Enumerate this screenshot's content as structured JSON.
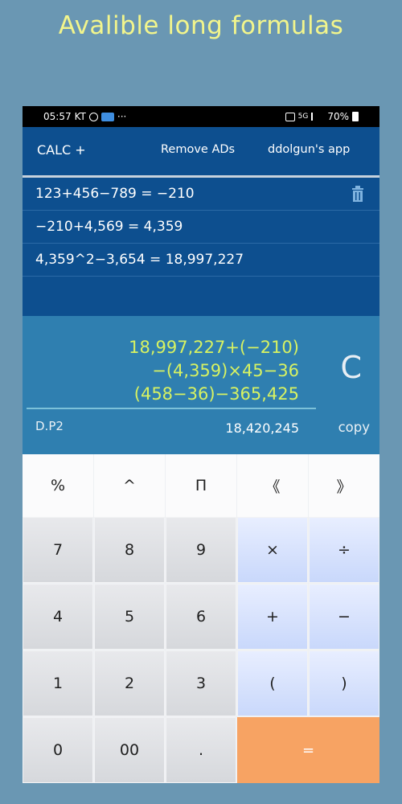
{
  "promo": {
    "title": "Avalible long formulas"
  },
  "status": {
    "time": "05:57",
    "carrier": "KT",
    "network": "5G",
    "battery": "70%"
  },
  "appbar": {
    "title": "CALC +",
    "remove_ads": "Remove ADs",
    "developer": "ddolgun's app"
  },
  "history": [
    {
      "text": "123+456−789 = −210"
    },
    {
      "text": "−210+4,569 = 4,359"
    },
    {
      "text": "4,359^2−3,654 = 18,997,227"
    },
    {
      "text": ""
    }
  ],
  "display": {
    "expression_lines": [
      "18,997,227+(−210)",
      "−(4,359)×45−36",
      "(458−36)−365,425"
    ],
    "clear_label": "C",
    "decimal_places": "D.P2",
    "result": "18,420,245",
    "copy_label": "copy"
  },
  "keypad": {
    "top_row": [
      "%",
      "^",
      "Π",
      "《",
      "》"
    ],
    "row1": [
      "7",
      "8",
      "9",
      "×",
      "÷"
    ],
    "row2": [
      "4",
      "5",
      "6",
      "+",
      "−"
    ],
    "row3": [
      "1",
      "2",
      "3",
      "(",
      ")"
    ],
    "row4": [
      "0",
      "00",
      ".",
      "="
    ]
  },
  "colors": {
    "accent": "#0d4f8f",
    "expression": "#d7f262",
    "equals_key": "#f7a363"
  }
}
